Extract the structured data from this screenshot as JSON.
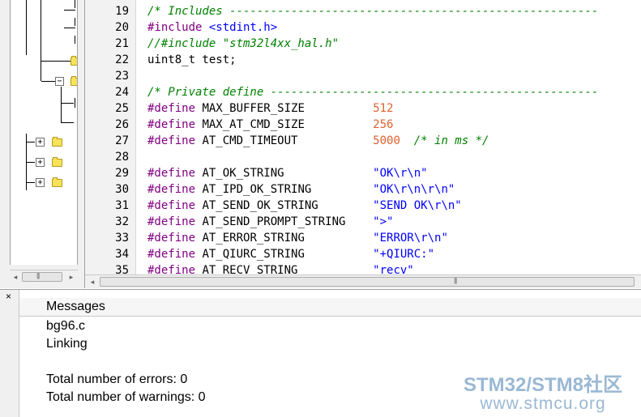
{
  "editor": {
    "lines": [
      {
        "num": "19",
        "parts": [
          {
            "t": "/* Includes ------------------------------------------------------",
            "c": "comment"
          }
        ]
      },
      {
        "num": "20",
        "parts": [
          {
            "t": "#include ",
            "c": "pre"
          },
          {
            "t": "<stdint.h>",
            "c": "inc"
          }
        ]
      },
      {
        "num": "21",
        "parts": [
          {
            "t": "//#include \"stm32l4xx_hal.h\"",
            "c": "comment"
          }
        ]
      },
      {
        "num": "22",
        "parts": [
          {
            "t": "uint8_t test;",
            "c": "plain"
          }
        ]
      },
      {
        "num": "23",
        "parts": []
      },
      {
        "num": "24",
        "parts": [
          {
            "t": "/* Private define ------------------------------------------------",
            "c": "comment"
          }
        ]
      },
      {
        "num": "25",
        "parts": [
          {
            "t": "#define ",
            "c": "pre"
          },
          {
            "t": "MAX_BUFFER_SIZE          ",
            "c": "plain"
          },
          {
            "t": "512",
            "c": "num"
          }
        ]
      },
      {
        "num": "26",
        "parts": [
          {
            "t": "#define ",
            "c": "pre"
          },
          {
            "t": "MAX_AT_CMD_SIZE          ",
            "c": "plain"
          },
          {
            "t": "256",
            "c": "num"
          }
        ]
      },
      {
        "num": "27",
        "parts": [
          {
            "t": "#define ",
            "c": "pre"
          },
          {
            "t": "AT_CMD_TIMEOUT           ",
            "c": "plain"
          },
          {
            "t": "5000",
            "c": "num"
          },
          {
            "t": "  /* in ms */",
            "c": "comment"
          }
        ]
      },
      {
        "num": "28",
        "parts": []
      },
      {
        "num": "29",
        "parts": [
          {
            "t": "#define ",
            "c": "pre"
          },
          {
            "t": "AT_OK_STRING             ",
            "c": "plain"
          },
          {
            "t": "\"OK\\r\\n\"",
            "c": "str"
          }
        ]
      },
      {
        "num": "30",
        "parts": [
          {
            "t": "#define ",
            "c": "pre"
          },
          {
            "t": "AT_IPD_OK_STRING         ",
            "c": "plain"
          },
          {
            "t": "\"OK\\r\\n\\r\\n\"",
            "c": "str"
          }
        ]
      },
      {
        "num": "31",
        "parts": [
          {
            "t": "#define ",
            "c": "pre"
          },
          {
            "t": "AT_SEND_OK_STRING        ",
            "c": "plain"
          },
          {
            "t": "\"SEND OK\\r\\n\"",
            "c": "str"
          }
        ]
      },
      {
        "num": "32",
        "parts": [
          {
            "t": "#define ",
            "c": "pre"
          },
          {
            "t": "AT_SEND_PROMPT_STRING    ",
            "c": "plain"
          },
          {
            "t": "\">\"",
            "c": "str"
          }
        ]
      },
      {
        "num": "33",
        "parts": [
          {
            "t": "#define ",
            "c": "pre"
          },
          {
            "t": "AT_ERROR_STRING          ",
            "c": "plain"
          },
          {
            "t": "\"ERROR\\r\\n\"",
            "c": "str"
          }
        ]
      },
      {
        "num": "34",
        "parts": [
          {
            "t": "#define ",
            "c": "pre"
          },
          {
            "t": "AT_QIURC_STRING          ",
            "c": "plain"
          },
          {
            "t": "\"+QIURC:\"",
            "c": "str"
          }
        ]
      },
      {
        "num": "35",
        "parts": [
          {
            "t": "#define ",
            "c": "pre"
          },
          {
            "t": "AT_RECV_STRING           ",
            "c": "plain"
          },
          {
            "t": "\"recv\"",
            "c": "str"
          }
        ]
      }
    ]
  },
  "messages": {
    "header": "Messages",
    "lines": [
      "bg96.c",
      "Linking",
      "",
      "Total number of errors: 0",
      "Total number of warnings: 0"
    ],
    "close_glyph": "×"
  },
  "watermark": {
    "title": "STM32/STM8社区",
    "url": "www.stmcu.org"
  },
  "icons": {
    "expand": "+",
    "collapse": "−",
    "scroll_left": "◂",
    "scroll_right": "▸",
    "grip": "|||"
  }
}
